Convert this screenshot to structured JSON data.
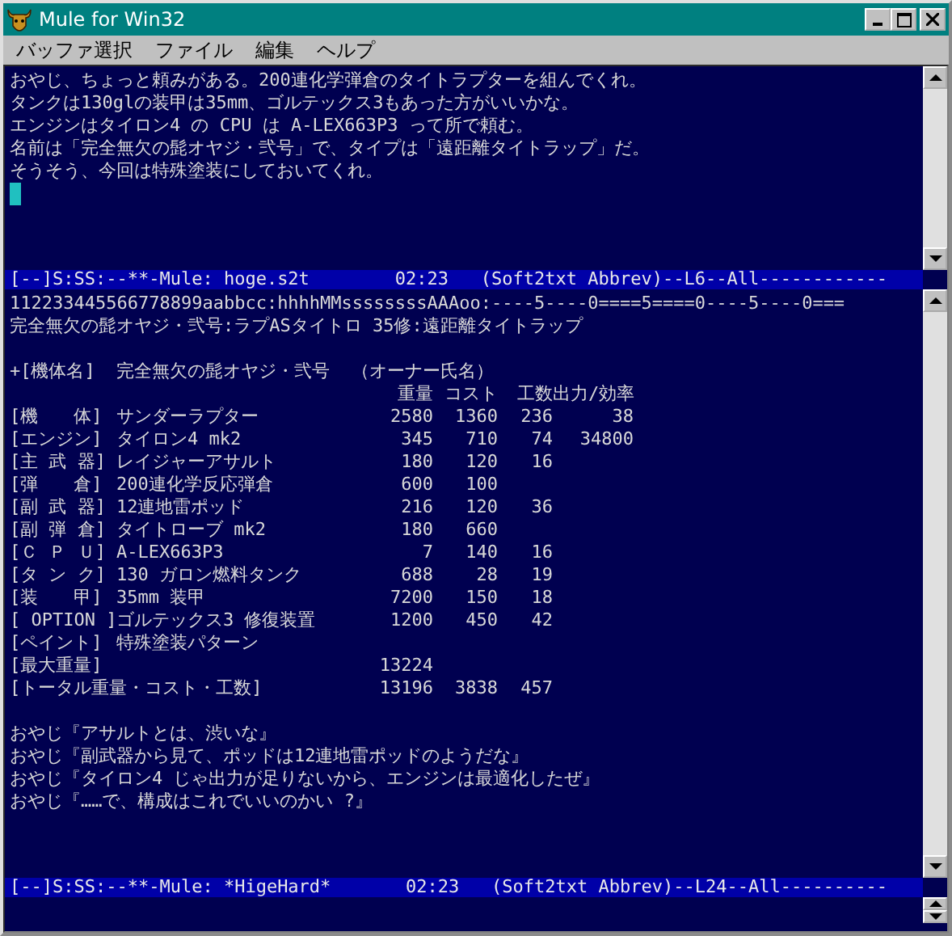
{
  "window": {
    "title": "Mule for Win32"
  },
  "menu": [
    "バッファ選択",
    "ファイル",
    "編集",
    "ヘルプ"
  ],
  "top_pane": {
    "lines": [
      "おやじ、ちょっと頼みがある。200連化学弾倉のタイトラプターを組んでくれ。",
      "タンクは130glの装甲は35mm、ゴルテックス3もあった方がいいかな。",
      "エンジンはタイロン4 の CPU は A-LEX663P3 って所で頼む。",
      "名前は「完全無欠の髭オヤジ・弐号」で、タイプは「遠距離タイトラップ」だ。",
      "そうそう、今回は特殊塗装にしておいてくれ。"
    ],
    "cursor": true
  },
  "mode_line_1": "[--]S:SS:--**-Mule: hoge.s2t        02:23   (Soft2txt Abbrev)--L6--All------------",
  "bottom_pane": {
    "ruler": "112233445566778899aabbcc:hhhhMMssssssssAAAoo:----5----0====5====0----5----0===",
    "summary": "完全無欠の髭オヤジ・弐号:ラプASタイトロ 35修:遠距離タイトラップ",
    "heading": "+[機体名]  完全無欠の髭オヤジ・弐号  （オーナー氏名）",
    "columns": [
      "重量",
      "コスト",
      "工数",
      "出力/効率"
    ],
    "rows": [
      {
        "kind": "part",
        "label": "[機　　体]",
        "name": "サンダーラプター",
        "values": [
          "2580",
          "1360",
          "236",
          "38"
        ]
      },
      {
        "kind": "part",
        "label": "[エンジン]",
        "name": "タイロン4 mk2",
        "values": [
          "345",
          "710",
          "74",
          "34800"
        ]
      },
      {
        "kind": "part",
        "label": "[主 武 器]",
        "name": "レイジャーアサルト",
        "values": [
          "180",
          "120",
          "16"
        ]
      },
      {
        "kind": "part",
        "label": "[弾　　倉]",
        "name": "200連化学反応弾倉",
        "values": [
          "600",
          "100"
        ]
      },
      {
        "kind": "part",
        "label": "[副 武 器]",
        "name": "12連地雷ポッド",
        "values": [
          "216",
          "120",
          "36"
        ]
      },
      {
        "kind": "part",
        "label": "[副 弾 倉]",
        "name": "タイトローブ mk2",
        "values": [
          "180",
          "660"
        ]
      },
      {
        "kind": "part",
        "label": "[Ｃ Ｐ Ｕ]",
        "name": "A-LEX663P3",
        "values": [
          "7",
          "140",
          "16"
        ]
      },
      {
        "kind": "part",
        "label": "[タ ン ク]",
        "name": "130 ガロン燃料タンク",
        "values": [
          "688",
          "28",
          "19"
        ]
      },
      {
        "kind": "part",
        "label": "[装　　甲]",
        "name": "35mm 装甲",
        "values": [
          "7200",
          "150",
          "18"
        ]
      },
      {
        "kind": "part",
        "label": "[ OPTION ]",
        "name": "ゴルテックス3 修復装置",
        "values": [
          "1200",
          "450",
          "42"
        ]
      },
      {
        "kind": "part",
        "label": "[ペイント]",
        "name": "特殊塗装パターン",
        "values": []
      },
      {
        "kind": "total",
        "label": "[最大重量]",
        "values": [
          "13224"
        ]
      },
      {
        "kind": "total",
        "label": "[トータル重量・コスト・工数]",
        "values": [
          "13196",
          "3838",
          "457"
        ]
      }
    ],
    "dialogue": [
      "おやじ『アサルトとは、渋いな』",
      "おやじ『副武器から見て、ポッドは12連地雷ポッドのようだな』",
      "おやじ『タイロン4 じゃ出力が足りないから、エンジンは最適化したぜ』",
      "おやじ『……で、構成はこれでいいのかい ?』"
    ]
  },
  "mode_line_2": "[--]S:SS:--**-Mule: *HigeHard*       02:23   (Soft2txt Abbrev)--L24--All----------"
}
